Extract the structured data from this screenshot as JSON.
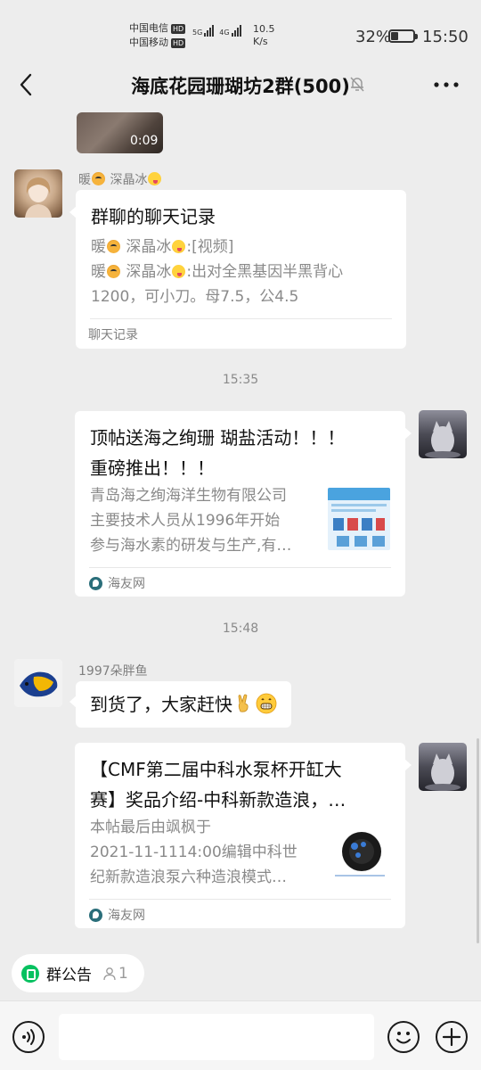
{
  "status_bar": {
    "carrier1": "中国电信",
    "carrier2": "中国移动",
    "hd_badge": "HD",
    "sig1_label": "5G",
    "sig2_label": "4G",
    "net_speed_value": "10.5",
    "net_speed_unit": "K/s",
    "battery_percent": "32%",
    "battery_level": 0.32,
    "time": "15:50"
  },
  "header": {
    "title": "海底花园珊瑚坊2群(500)",
    "back_icon": "chevron-left-icon",
    "mute_icon": "bell-off-icon",
    "more_icon": "more-dots-icon"
  },
  "messages": {
    "video": {
      "duration": "0:09"
    },
    "m1": {
      "sender_name_a": "暖",
      "sender_name_b": "深晶冰",
      "card_title": "群聊的聊天记录",
      "line1_a": "暖",
      "line1_b": "深晶冰",
      "line1_c": ":[视频]",
      "line2_a": "暖",
      "line2_b": "深晶冰",
      "line2_c": ":出对全黑基因半黑背心",
      "line3": "1200，可小刀。母7.5，公4.5",
      "footer": "聊天记录"
    },
    "time1": "15:35",
    "m2": {
      "title_line1": "顶帖送海之绚珊 瑚盐活动！！！",
      "title_line2": "重磅推出！！！",
      "desc_line1": "青岛海之绚海洋生物有限公司",
      "desc_line2": "主要技术人员从1996年开始",
      "desc_line3": "参与海水素的研发与生产,有…",
      "source": "海友网"
    },
    "time2": "15:48",
    "m3": {
      "sender": "1997朵胖鱼",
      "text": "到货了，大家赶快"
    },
    "m4": {
      "title_line1": "【CMF第二届中科水泵杯开缸大",
      "title_line2": "赛】奖品介绍-中科新款造浪，…",
      "desc_line1": "本帖最后由飒枫于",
      "desc_line2": "2021-11-1114:00编辑中科世",
      "desc_line3": "纪新款造浪泵六种造浪模式…",
      "source": "海友网"
    }
  },
  "announcement": {
    "label": "群公告",
    "count": "1"
  },
  "input_bar": {
    "voice_icon": "voice-icon",
    "emoji_icon": "emoji-face-icon",
    "plus_icon": "plus-icon"
  },
  "colors": {
    "background": "#ededed",
    "bubble": "#ffffff",
    "accent_green": "#07c160",
    "muted_text": "#8a8a8a"
  }
}
